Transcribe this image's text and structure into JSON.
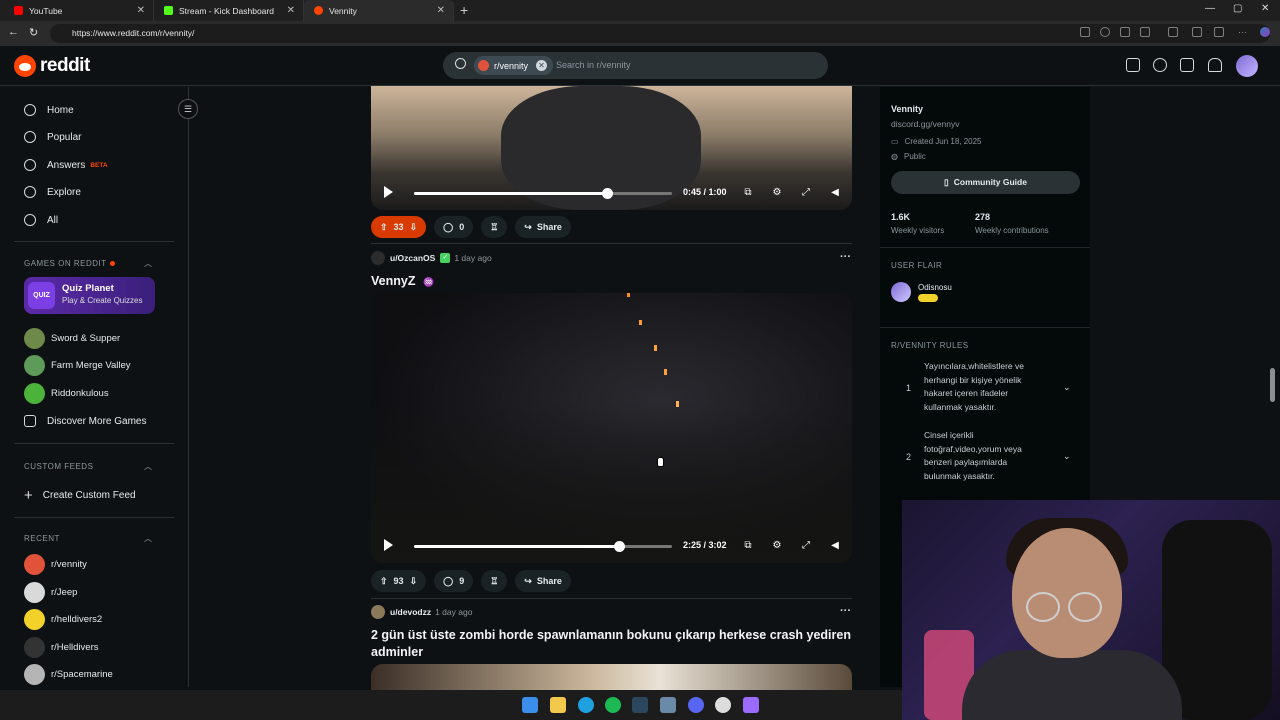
{
  "browser": {
    "tabs": [
      {
        "label": "YouTube",
        "color": "#ff0000"
      },
      {
        "label": "Stream - Kick Dashboard",
        "color": "#53fc18"
      },
      {
        "label": "Vennity",
        "color": "#ff4500"
      }
    ],
    "url": "https://www.reddit.com/r/vennity/"
  },
  "header": {
    "logo_text": "reddit",
    "search_chip": "r/vennity",
    "search_placeholder": "Search in r/vennity"
  },
  "sidebar": {
    "nav": [
      {
        "label": "Home",
        "icon": "home-icon"
      },
      {
        "label": "Popular",
        "icon": "popular-icon"
      },
      {
        "label": "Answers",
        "icon": "answers-icon",
        "badge": "BETA"
      },
      {
        "label": "Explore",
        "icon": "explore-icon"
      },
      {
        "label": "All",
        "icon": "all-icon"
      }
    ],
    "games_title": "GAMES ON REDDIT",
    "quiz": {
      "title": "Quiz Planet",
      "subtitle": "Play & Create Quizzes",
      "icon_text": "QUIZ"
    },
    "games": [
      "Sword & Supper",
      "Farm Merge Valley",
      "Riddonkulous"
    ],
    "discover_more": "Discover More Games",
    "custom_feeds_title": "CUSTOM FEEDS",
    "create_custom_feed": "Create Custom Feed",
    "recent_title": "RECENT",
    "recent": [
      "r/vennity",
      "r/Jeep",
      "r/helldivers2",
      "r/Helldivers",
      "r/Spacemarine"
    ]
  },
  "feed": {
    "video1": {
      "time": "0:45 / 1:00",
      "progress": 0.75
    },
    "post1_actions": {
      "votes": "33",
      "comments": "0",
      "share": "Share"
    },
    "post2": {
      "user": "u/OzcanOS",
      "ago": "1 day ago",
      "title": "VennyZ",
      "video_time": "2:25 / 3:02",
      "progress": 0.8,
      "votes": "93",
      "comments": "9",
      "share": "Share"
    },
    "post3": {
      "user": "u/devodzz",
      "ago": "1 day ago",
      "title_line1": "2 gün üst üste zombi horde spawnlamanın bokunu çıkarıp herkese crash yediren",
      "title_line2": "adminler"
    }
  },
  "community": {
    "name": "Vennity",
    "link": "discord.gg/vennyv",
    "created": "Created Jun 18, 2025",
    "visibility": "Public",
    "guide_button": "Community Guide",
    "visitors": "1.6K",
    "visitors_label": "Weekly visitors",
    "contributions": "278",
    "contributions_label": "Weekly contributions",
    "user_flair_title": "USER FLAIR",
    "flair_user": "Odisnosu",
    "rules_title": "R/VENNITY RULES",
    "rules": [
      {
        "n": "1",
        "line1": "Yayıncılara,whitelistlere ve",
        "line2": "herhangi bir kişiye yönelik",
        "line3": "hakaret içeren ifadeler",
        "line4": "kullanmak yasaktır."
      },
      {
        "n": "2",
        "line1": "Cinsel içerikli",
        "line2": "fotoğraf,video,yorum veya",
        "line3": "benzeri paylaşımlarda",
        "line4": "bulunmak yasaktır."
      }
    ]
  }
}
